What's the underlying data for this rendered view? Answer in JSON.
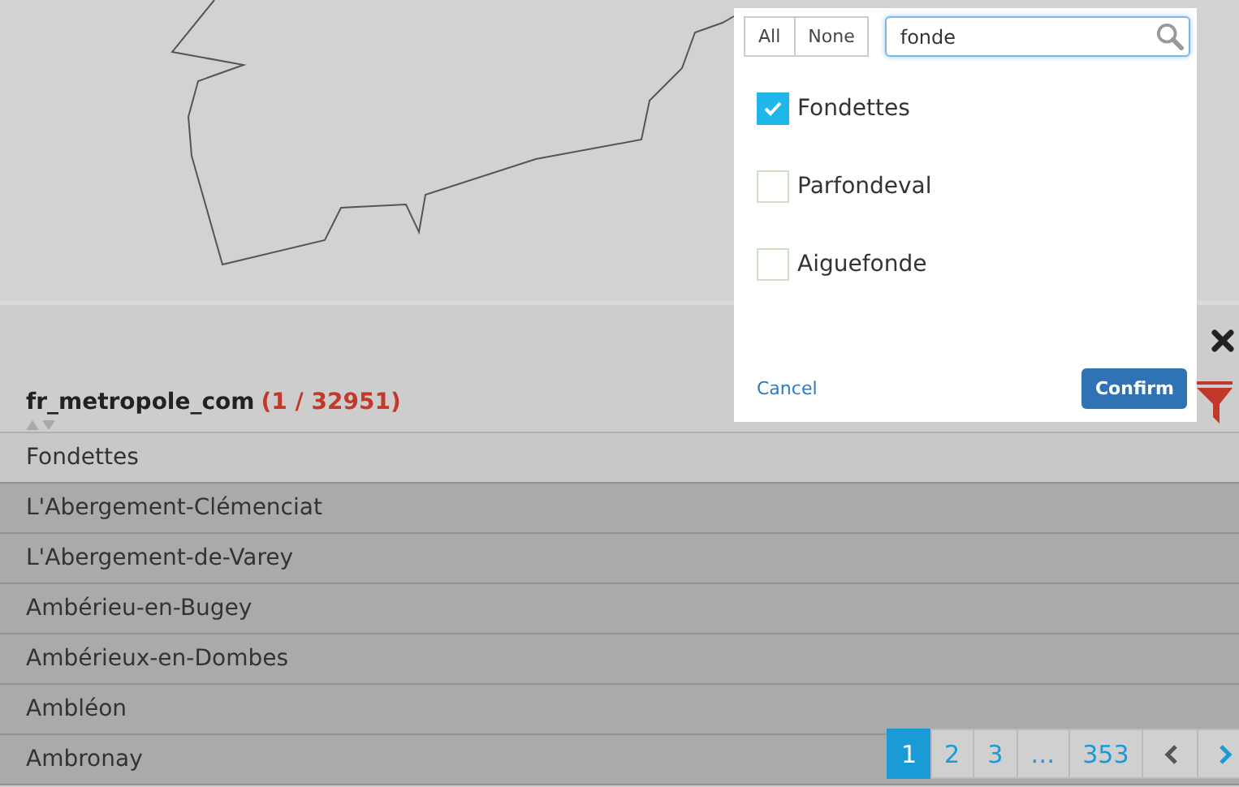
{
  "layer": {
    "name": "fr_metropole_com",
    "count": "(1 / 32951)"
  },
  "rows": [
    {
      "name": "Fondettes",
      "selected": true
    },
    {
      "name": "L'Abergement-Clémenciat",
      "selected": false
    },
    {
      "name": "L'Abergement-de-Varey",
      "selected": false
    },
    {
      "name": "Ambérieu-en-Bugey",
      "selected": false
    },
    {
      "name": "Ambérieux-en-Dombes",
      "selected": false
    },
    {
      "name": "Ambléon",
      "selected": false
    },
    {
      "name": "Ambronay",
      "selected": false
    }
  ],
  "pagination": [
    {
      "label": "1",
      "selected": true
    },
    {
      "label": "2",
      "selected": false
    },
    {
      "label": "3",
      "selected": false
    },
    {
      "label": "…",
      "selected": false
    },
    {
      "label": "353",
      "selected": false
    }
  ],
  "filter": {
    "all_label": "All",
    "none_label": "None",
    "search": "fonde",
    "options": [
      {
        "label": "Fondettes",
        "checked": true
      },
      {
        "label": "Parfondeval",
        "checked": false
      },
      {
        "label": "Aiguefonde",
        "checked": false
      }
    ],
    "cancel": "Cancel",
    "confirm": "Confirm"
  }
}
